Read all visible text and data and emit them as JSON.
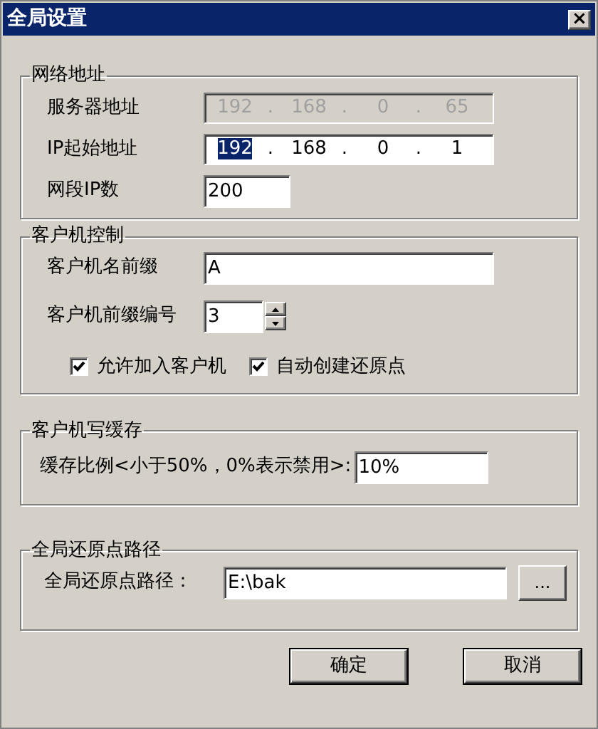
{
  "window": {
    "title": "全局设置",
    "close": "×"
  },
  "network": {
    "title": "网络地址",
    "server": {
      "label": "服务器地址",
      "disabled": true,
      "octets": [
        {
          "text": "192",
          "selected": false
        },
        {
          "text": "168",
          "selected": false
        },
        {
          "text": "0",
          "selected": false
        },
        {
          "text": "65",
          "selected": false
        }
      ],
      "separators": [
        ".",
        ".",
        "."
      ]
    },
    "start_ip": {
      "label": "IP起始地址",
      "disabled": false,
      "octets": [
        {
          "text": "192",
          "selected": true
        },
        {
          "text": "168",
          "selected": false
        },
        {
          "text": "0",
          "selected": false
        },
        {
          "text": "1",
          "selected": false
        }
      ],
      "separators": [
        ".",
        ".",
        "."
      ]
    },
    "count": {
      "label": "网段IP数",
      "value": "200"
    }
  },
  "client": {
    "title": "客户机控制",
    "prefix": {
      "label": "客户机名前缀",
      "value": "A"
    },
    "number": {
      "label": "客户机前缀编号",
      "value": "3"
    },
    "checkboxes": [
      {
        "label": "允许加入客户机",
        "checked": true
      },
      {
        "label": "自动创建还原点",
        "checked": true
      }
    ]
  },
  "cache": {
    "title": "客户机写缓存",
    "label": "缓存比例<小于50%，0%表示禁用>:",
    "value": "10%"
  },
  "restore": {
    "title": "全局还原点路径",
    "label": "全局还原点路径：",
    "value": "E:\\bak",
    "browse": "..."
  },
  "buttons": [
    {
      "label": "确定"
    },
    {
      "label": "取消"
    }
  ]
}
